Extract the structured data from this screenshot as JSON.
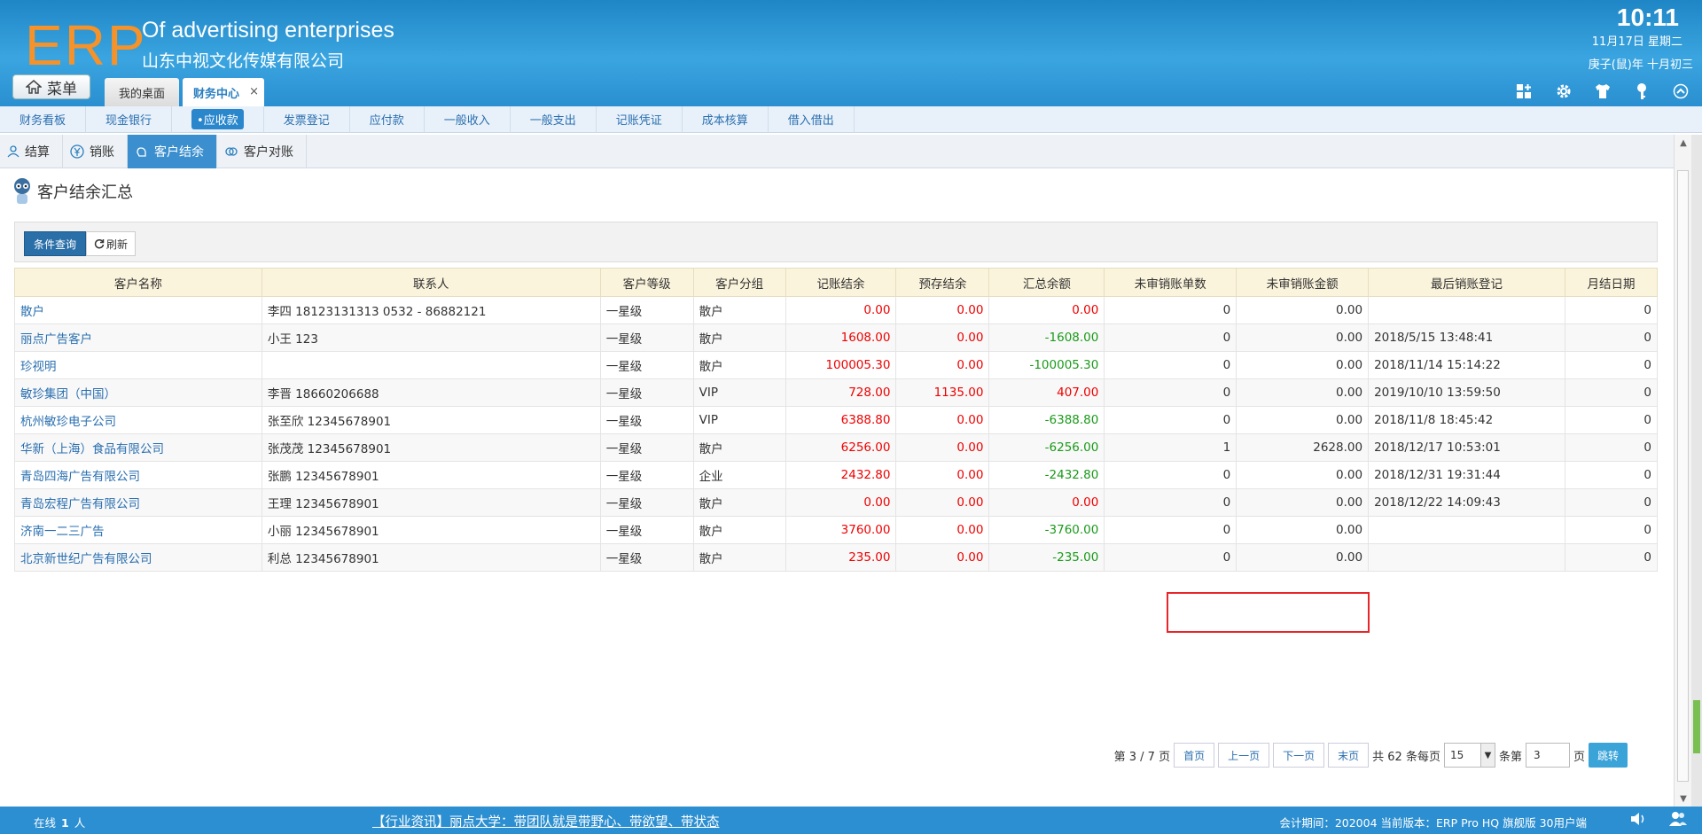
{
  "header": {
    "logo": "ERP",
    "company_en": "Of advertising enterprises",
    "company_cn": "山东中视文化传媒有限公司",
    "time": "10:11",
    "date": "11月17日 星期二",
    "lunar": "庚子(鼠)年 十月初三",
    "menu_label": "菜单",
    "tabs": [
      {
        "label": "我的桌面"
      },
      {
        "label": "财务中心",
        "close": "×"
      }
    ],
    "icons": [
      "grid-add-icon",
      "gear-icon",
      "shirt-icon",
      "key-icon",
      "collapse-icon"
    ]
  },
  "modnav": [
    "财务看板",
    "现金银行",
    "•应收款",
    "发票登记",
    "应付款",
    "一般收入",
    "一般支出",
    "记账凭证",
    "成本核算",
    "借入借出"
  ],
  "subtabs": [
    "结算",
    "销账",
    "客户结余",
    "客户对账"
  ],
  "page_title": "客户结余汇总",
  "toolbar": {
    "query": "条件查询",
    "refresh": "刷新"
  },
  "table": {
    "columns": [
      "客户名称",
      "联系人",
      "客户等级",
      "客户分组",
      "记账结余",
      "预存结余",
      "汇总余额",
      "未审销账单数",
      "未审销账金额",
      "最后销账登记",
      "月结日期"
    ],
    "rows": [
      [
        "散户",
        "李四 18123131313 0532 - 86882121",
        "一星级",
        "散户",
        "0.00",
        "0.00",
        "0.00",
        "0",
        "0.00",
        "",
        "0"
      ],
      [
        "丽点广告客户",
        "小王 123",
        "一星级",
        "散户",
        "1608.00",
        "0.00",
        "-1608.00",
        "0",
        "0.00",
        "2018/5/15 13:48:41",
        "0"
      ],
      [
        "珍视明",
        "",
        "一星级",
        "散户",
        "100005.30",
        "0.00",
        "-100005.30",
        "0",
        "0.00",
        "2018/11/14 15:14:22",
        "0"
      ],
      [
        "敏珍集团（中国）",
        "李晋 18660206688",
        "一星级",
        "VIP",
        "728.00",
        "1135.00",
        "407.00",
        "0",
        "0.00",
        "2019/10/10 13:59:50",
        "0"
      ],
      [
        "杭州敏珍电子公司",
        "张至欣 12345678901",
        "一星级",
        "VIP",
        "6388.80",
        "0.00",
        "-6388.80",
        "0",
        "0.00",
        "2018/11/8 18:45:42",
        "0"
      ],
      [
        "华新（上海）食品有限公司",
        "张茂茂 12345678901",
        "一星级",
        "散户",
        "6256.00",
        "0.00",
        "-6256.00",
        "1",
        "2628.00",
        "2018/12/17 10:53:01",
        "0"
      ],
      [
        "青岛四海广告有限公司",
        "张鹏 12345678901",
        "一星级",
        "企业",
        "2432.80",
        "0.00",
        "-2432.80",
        "0",
        "0.00",
        "2018/12/31 19:31:44",
        "0"
      ],
      [
        "青岛宏程广告有限公司",
        "王理 12345678901",
        "一星级",
        "散户",
        "0.00",
        "0.00",
        "0.00",
        "0",
        "0.00",
        "2018/12/22 14:09:43",
        "0"
      ],
      [
        "济南一二三广告",
        "小丽 12345678901",
        "一星级",
        "散户",
        "3760.00",
        "0.00",
        "-3760.00",
        "0",
        "0.00",
        "",
        "0"
      ],
      [
        "北京新世纪广告有限公司",
        "利总 12345678901",
        "一星级",
        "散户",
        "235.00",
        "0.00",
        "-235.00",
        "0",
        "0.00",
        "",
        "0"
      ]
    ]
  },
  "pager": {
    "status": "第 3 / 7 页",
    "first": "首页",
    "prev": "上一页",
    "next": "下一页",
    "last": "末页",
    "total": "共 62 条每页",
    "page_size": "15",
    "goto_prefix": "条第",
    "goto_value": "3",
    "goto_suffix": "页",
    "go": "跳转"
  },
  "footer": {
    "online_prefix": "在线",
    "online_count": "1",
    "online_suffix": "人",
    "news": "【行业资讯】丽点大学：带团队就是带野心、带欲望、带状态",
    "info": "会计期间：202004 当前版本：ERP Pro HQ 旗舰版 30用户端"
  },
  "colors": {
    "header": "#2a8fd0",
    "logo": "#f5922a",
    "negative": "#1a9a1a",
    "positive": "#e00000",
    "highlight": "#e8262a"
  }
}
